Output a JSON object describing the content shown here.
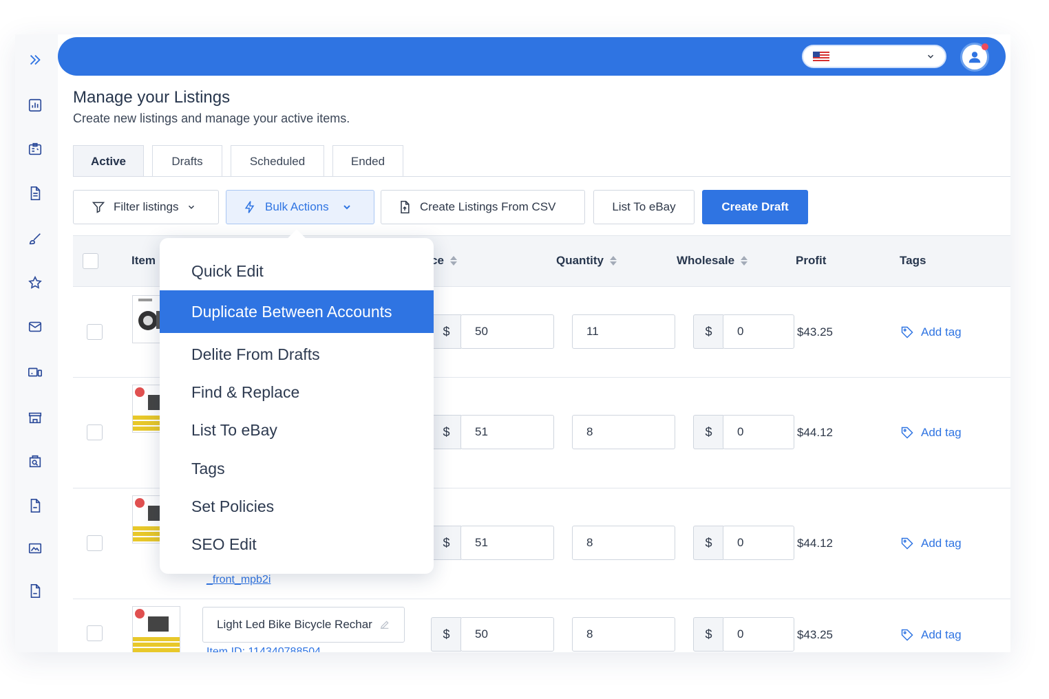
{
  "header": {
    "title": "Manage your Listings",
    "subtitle": "Create new listings and manage your active items."
  },
  "tabs": [
    {
      "label": "Active",
      "active": true
    },
    {
      "label": "Drafts",
      "active": false
    },
    {
      "label": "Scheduled",
      "active": false
    },
    {
      "label": "Ended",
      "active": false
    }
  ],
  "toolbar": {
    "filter_label": "Filter listings",
    "bulk_label": "Bulk Actions",
    "csv_label": "Create Listings From CSV",
    "list_ebay_label": "List To eBay",
    "create_draft_label": "Create Draft"
  },
  "table": {
    "columns": {
      "item": "Item",
      "price_partial": "ce",
      "quantity": "Quantity",
      "wholesale": "Wholesale",
      "profit": "Profit",
      "tags": "Tags"
    },
    "currency_symbol": "$",
    "add_tag_label": "Add tag",
    "rows": [
      {
        "price": "50",
        "quantity": "11",
        "wholesale": "0",
        "profit": "$43.25"
      },
      {
        "price": "51",
        "quantity": "8",
        "wholesale": "0",
        "profit": "$44.12"
      },
      {
        "price": "51",
        "quantity": "8",
        "wholesale": "0",
        "profit": "$44.12",
        "link_text": "_front_mpb2i"
      },
      {
        "price": "50",
        "quantity": "8",
        "wholesale": "0",
        "profit": "$43.25",
        "title": "Light Led Bike Bicycle Rechar",
        "item_id": "Item ID: 114340788504"
      }
    ]
  },
  "bulk_menu": {
    "items": [
      {
        "label": "Quick Edit",
        "active": false
      },
      {
        "label": "Duplicate Between Accounts",
        "active": true
      },
      {
        "label": "Delite From Drafts",
        "active": false
      },
      {
        "label": "Find & Replace",
        "active": false
      },
      {
        "label": "List To eBay",
        "active": false
      },
      {
        "label": "Tags",
        "active": false
      },
      {
        "label": "Set Policies",
        "active": false
      },
      {
        "label": "SEO Edit",
        "active": false
      }
    ]
  },
  "colors": {
    "accent": "#2f74e2",
    "notification": "#ef4a5a"
  },
  "icons": {
    "sidebar": [
      "expand-icon",
      "analytics-icon",
      "clipboard-icon",
      "document-icon",
      "brush-icon",
      "star-icon",
      "mail-icon",
      "devices-icon",
      "store-icon",
      "search-doc-icon",
      "pdf-icon",
      "image-icon",
      "csv-icon"
    ]
  }
}
